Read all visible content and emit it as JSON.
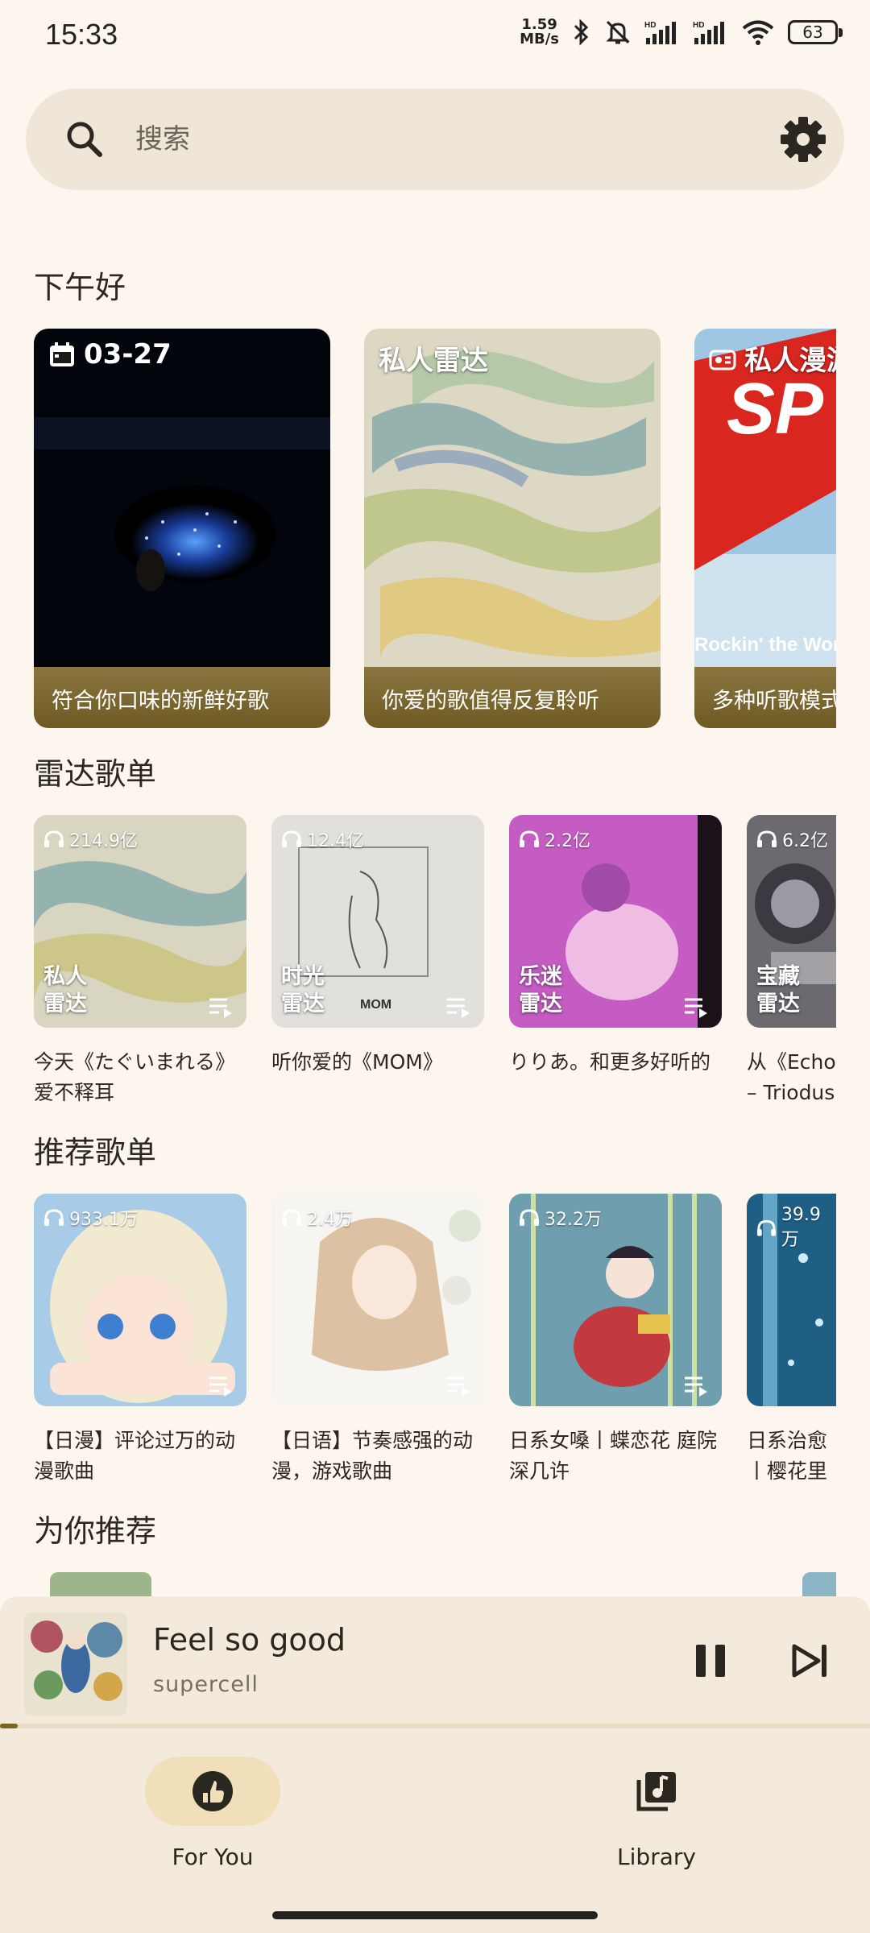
{
  "status_bar": {
    "time": "15:33",
    "net_speed_value": "1.59",
    "net_speed_unit": "MB/s",
    "battery": "63",
    "icons": [
      "bluetooth-icon",
      "mute-icon",
      "signal-hd-icon",
      "signal-hd-icon",
      "wifi-icon",
      "battery-icon"
    ]
  },
  "search": {
    "placeholder": "搜索",
    "icon": "search-icon",
    "settings_icon": "gear-icon"
  },
  "greeting": "下午好",
  "daily_cards": [
    {
      "label": "03-27",
      "icon": "calendar-icon",
      "caption": "符合你口味的新鲜好歌"
    },
    {
      "label": "私人雷达",
      "icon": "",
      "caption": "你爱的歌值得反复聆听"
    },
    {
      "label": "私人漫游",
      "icon": "radio-icon",
      "caption": "多种听歌模式",
      "art_text": "SP",
      "art_subtext": "Rockin' the World"
    }
  ],
  "radar_section": {
    "title": "雷达歌单",
    "items": [
      {
        "count": "214.9亿",
        "tag_line1": "私人",
        "tag_line2": "雷达",
        "desc": "今天《たぐいまれる》爱不释耳"
      },
      {
        "count": "12.4亿",
        "tag_line1": "时光",
        "tag_line2": "雷达",
        "desc": "听你爱的《MOM》"
      },
      {
        "count": "2.2亿",
        "tag_line1": "乐迷",
        "tag_line2": "雷达",
        "desc": "りりあ。和更多好听的"
      },
      {
        "count": "6.2亿",
        "tag_line1": "宝藏",
        "tag_line2": "雷达",
        "desc": "从《Echo – Triodus"
      }
    ]
  },
  "recommend_section": {
    "title": "推荐歌单",
    "items": [
      {
        "count": "933.1万",
        "desc": "【日漫】评论过万的动漫歌曲"
      },
      {
        "count": "2.4万",
        "desc": "【日语】节奏感强的动漫，游戏歌曲"
      },
      {
        "count": "32.2万",
        "desc": "日系女嗓丨蝶恋花 庭院深几许"
      },
      {
        "count": "39.9万",
        "desc": "日系治愈丨樱花里"
      }
    ]
  },
  "for_you_section": {
    "title": "为你推荐"
  },
  "player": {
    "song": "Feel so good",
    "artist": "supercell",
    "progress": 0.02,
    "pause_icon": "pause-icon",
    "next_icon": "skip-next-icon"
  },
  "nav": {
    "items": [
      {
        "label": "For You",
        "icon": "thumb-up-icon",
        "active": true
      },
      {
        "label": "Library",
        "icon": "music-library-icon",
        "active": false
      }
    ]
  },
  "colors": {
    "background": "#fdf6ee",
    "accent": "#7a6522",
    "pill": "#f0dfb8"
  }
}
